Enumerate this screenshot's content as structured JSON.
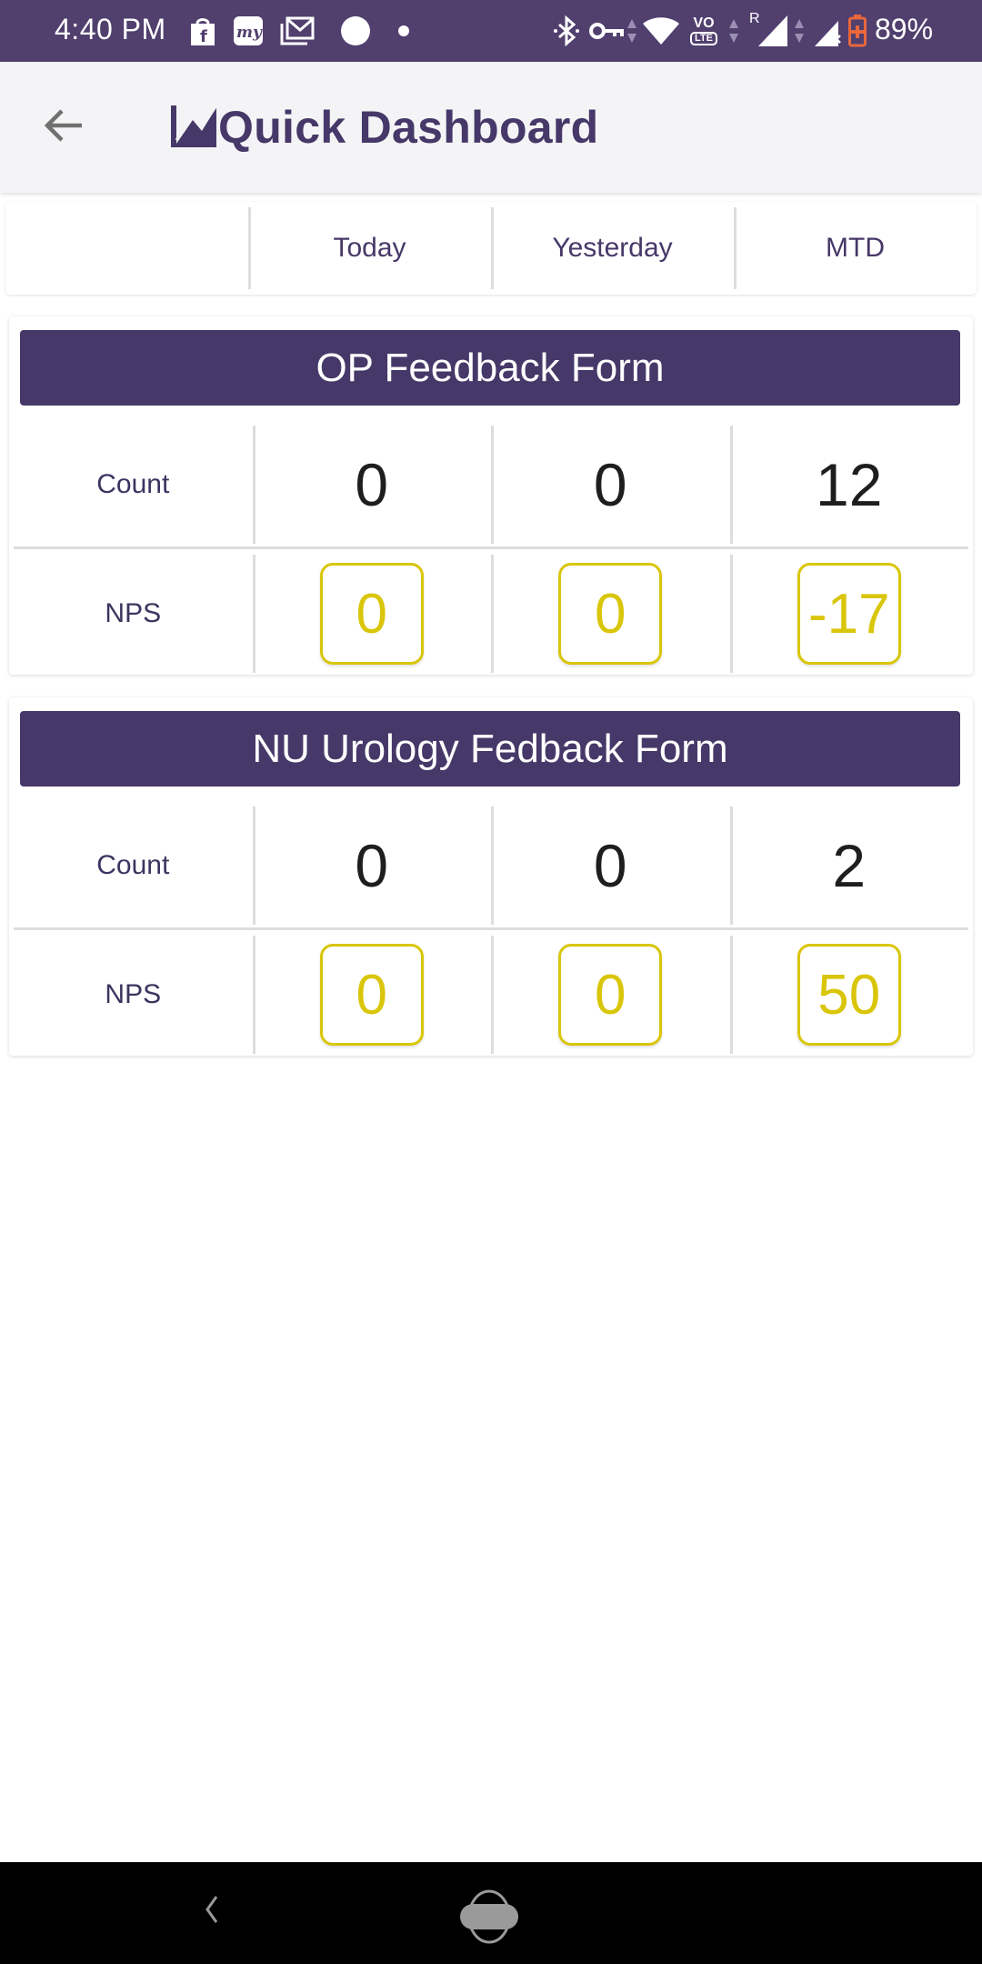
{
  "status_bar": {
    "time": "4:40 PM",
    "battery_percent": "89%",
    "notification_icons": [
      "flipkart-icon",
      "makemytrip-icon",
      "gmail-icon",
      "circle-icon",
      "dot-icon"
    ],
    "system_icons": [
      "bluetooth-icon",
      "vpn-key-icon",
      "wifi-icon",
      "volte-icon",
      "signal-roaming-icon",
      "signal-no-sim-icon",
      "battery-charging-icon"
    ],
    "roaming_indicator": "R",
    "volte_label": "VO",
    "lte_label": "LTE"
  },
  "app_bar": {
    "title": "Quick Dashboard",
    "title_icon": "area-chart-icon",
    "back_icon": "arrow-left-icon"
  },
  "periods": {
    "blank": "",
    "labels": [
      "Today",
      "Yesterday",
      "MTD"
    ]
  },
  "forms": [
    {
      "title": "OP Feedback Form",
      "count_label": "Count",
      "nps_label": "NPS",
      "count": [
        "0",
        "0",
        "12"
      ],
      "nps": [
        "0",
        "0",
        "-17"
      ]
    },
    {
      "title": "NU Urology Fedback Form",
      "count_label": "Count",
      "nps_label": "NPS",
      "count": [
        "0",
        "0",
        "2"
      ],
      "nps": [
        "0",
        "0",
        "50"
      ]
    }
  ],
  "colors": {
    "status_bar": "#513f6e",
    "brand_purple": "#463868",
    "nps_yellow": "#d9c60a",
    "divider": "#dddddd",
    "app_bar_bg": "#f4f4f6"
  },
  "nav_bar": {
    "back_icon": "nav-back-icon",
    "home_icon": "nav-home-icon"
  }
}
